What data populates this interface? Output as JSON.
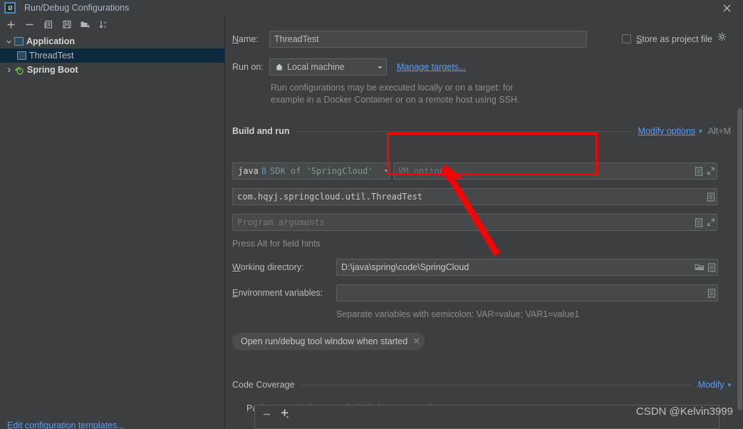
{
  "window": {
    "title": "Run/Debug Configurations",
    "app_logo": "IJ",
    "close_icon": "close-icon"
  },
  "sidebar": {
    "toolbar": [
      {
        "name": "add-configuration-button",
        "icon": "plus-icon",
        "label": "+"
      },
      {
        "name": "remove-configuration-button",
        "icon": "minus-icon",
        "label": "−"
      },
      {
        "name": "copy-configuration-button",
        "icon": "copy-icon",
        "label": "Copy"
      },
      {
        "name": "save-configuration-button",
        "icon": "save-icon",
        "label": "Save"
      },
      {
        "name": "new-folder-button",
        "icon": "folder-add-icon",
        "label": "New Folder"
      },
      {
        "name": "sort-configurations-button",
        "icon": "sort-az-icon",
        "label": "Sort"
      }
    ],
    "tree": [
      {
        "label": "Application",
        "icon": "application-icon",
        "expanded": true,
        "level": 0,
        "selected": false,
        "chevron": "⌄"
      },
      {
        "label": "ThreadTest",
        "icon": "application-icon",
        "level": 1,
        "selected": true,
        "chevron": ""
      },
      {
        "label": "Spring Boot",
        "icon": "spring-boot-icon",
        "expanded": false,
        "level": 0,
        "selected": false,
        "chevron": "›"
      }
    ],
    "bottom_link": "Edit configuration templates..."
  },
  "form": {
    "name_label": "Name:",
    "name_value": "ThreadTest",
    "store_as_project_file_label": "Store as project file",
    "store_as_project_file_checked": false,
    "store_gear_icon": "gear-icon",
    "run_on_label": "Run on:",
    "run_on_value": "Local machine",
    "run_on_icon": "local-machine-icon",
    "manage_targets_link": "Manage targets...",
    "run_on_hint_line1": "Run configurations may be executed locally or on a target: for",
    "run_on_hint_line2": "example in a Docker Container or on a remote host using SSH."
  },
  "build_and_run": {
    "section_title": "Build and run",
    "modify_options_link": "Modify options",
    "modify_options_shortcut": "Alt+M",
    "sdk_prefix": "java",
    "sdk_version": "8",
    "sdk_suffix": "SDK of 'SpringCloud'",
    "vm_options_placeholder": "VM options",
    "vm_options_value": "",
    "main_class_value": "com.hqyj.springcloud.util.ThreadTest",
    "program_arguments_placeholder": "Program arguments",
    "program_arguments_value": "",
    "field_hints_text": "Press Alt for field hints",
    "macro_icon": "macro-list-icon",
    "expand_icon": "expand-icon",
    "browse_icon": "browse-folder-icon"
  },
  "directories": {
    "working_directory_label": "Working directory:",
    "working_directory_value": "D:\\java\\spring\\code\\SpringCloud",
    "environment_variables_label": "Environment variables:",
    "environment_variables_value": "",
    "environment_hint": "Separate variables with semicolon: VAR=value; VAR1=value1",
    "chip_label": "Open run/debug tool window when started",
    "chip_close_icon": "close-chip-icon"
  },
  "code_coverage": {
    "section_title": "Code Coverage",
    "modify_link": "Modify",
    "subsection_title": "Packages and classes to include in coverage data",
    "remove_button_icon": "minus-icon",
    "add_button_icon": "plus-dropdown-icon"
  },
  "annotation": {
    "rect_color": "#ff0000",
    "arrow_color": "#ff0000",
    "target": "vm-options-field"
  },
  "watermark": "CSDN @Kelvin3999",
  "colors": {
    "background": "#3c3f41",
    "field_background": "#45494a",
    "selection": "#0d293e",
    "link": "#589df6",
    "text": "#bbbbbb",
    "accent_red": "#ff0000"
  }
}
